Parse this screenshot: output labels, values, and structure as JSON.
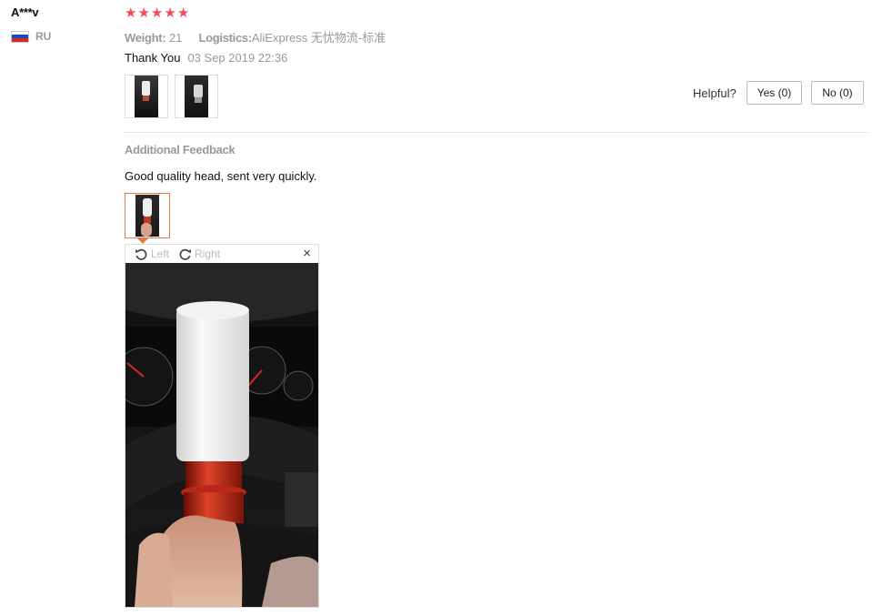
{
  "review": {
    "user": "A***v",
    "country_code": "RU",
    "rating": 5,
    "star_glyph": "★",
    "weight_label": "Weight:",
    "weight_value": "21",
    "logistics_label": "Logistics:",
    "logistics_value": "AliExpress 无忧物流-标准",
    "text": "Thank You",
    "date": "03 Sep 2019 22:36"
  },
  "helpful": {
    "label": "Helpful?",
    "yes_label": "Yes (0)",
    "no_label": "No (0)"
  },
  "additional": {
    "title": "Additional Feedback",
    "text": "Good quality head, sent very quickly."
  },
  "viewer": {
    "left_label": "Left",
    "right_label": "Right",
    "close_glyph": "×"
  },
  "colors": {
    "star": "#ef4c58",
    "selected_border": "#e37c3a"
  }
}
